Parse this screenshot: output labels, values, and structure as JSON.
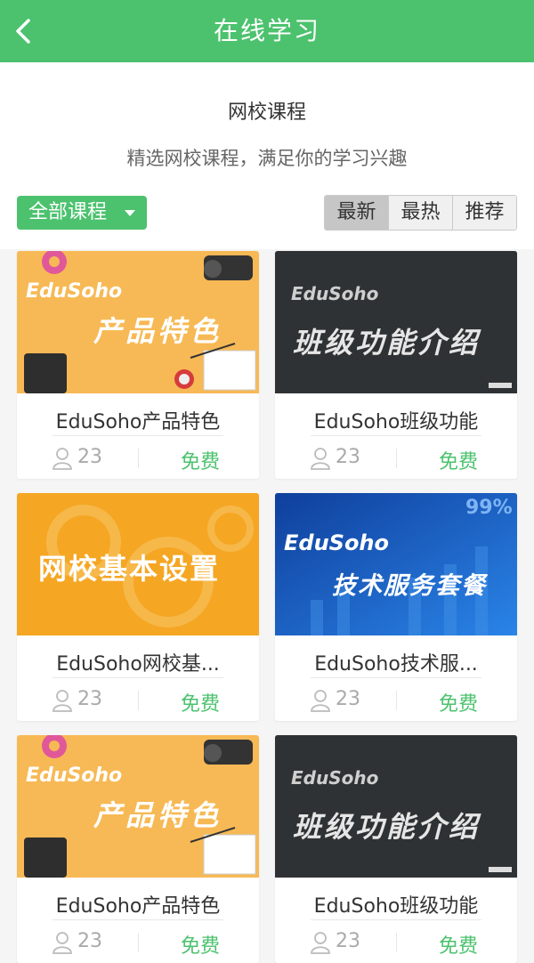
{
  "header": {
    "title": "在线学习",
    "back_icon": "chevron-left-icon",
    "color": "#4cc26e"
  },
  "intro": {
    "heading": "网校课程",
    "subtitle": "精选网校课程，满足你的学习兴趣"
  },
  "filter": {
    "category_label": "全部课程",
    "sort_tabs": [
      "最新",
      "最热",
      "推荐"
    ],
    "active_sort": "最新"
  },
  "courses": [
    {
      "title": "EduSoho产品特色",
      "thumb_brand": "EduSoho",
      "thumb_text": "产品特色",
      "students": "23",
      "price": "免费"
    },
    {
      "title": "EduSoho班级功能",
      "thumb_brand": "EduSoho",
      "thumb_text": "班级功能介绍",
      "students": "23",
      "price": "免费"
    },
    {
      "title": "EduSoho网校基...",
      "thumb_text": "网校基本设置",
      "students": "23",
      "price": "免费"
    },
    {
      "title": "EduSoho技术服...",
      "thumb_brand": "EduSoho",
      "thumb_text": "技术服务套餐",
      "thumb_extra": "99%",
      "students": "23",
      "price": "免费"
    },
    {
      "title": "EduSoho产品特色",
      "thumb_brand": "EduSoho",
      "thumb_text": "产品特色",
      "students": "23",
      "price": "免费"
    },
    {
      "title": "EduSoho班级功能",
      "thumb_brand": "EduSoho",
      "thumb_text": "班级功能介绍",
      "students": "23",
      "price": "免费"
    }
  ]
}
